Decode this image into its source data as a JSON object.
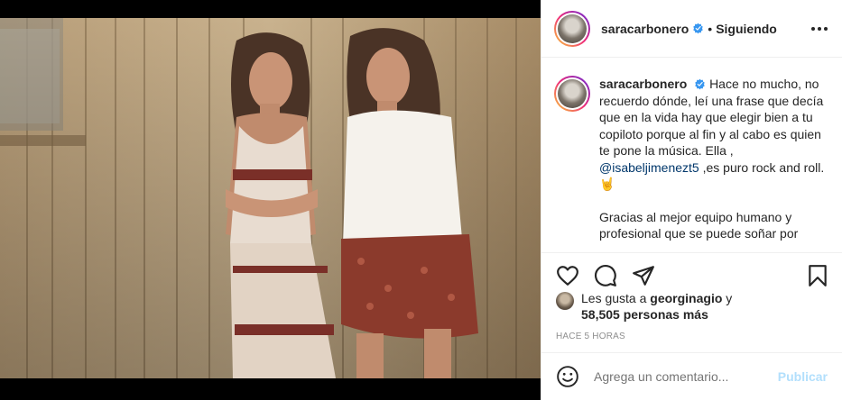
{
  "post": {
    "image_alt": "Two women leaning against a weathered wooden wall",
    "username": "saracarbonero",
    "separator": "•",
    "follow_status": "Siguiendo"
  },
  "caption": {
    "username": "saracarbonero",
    "text_before_mention": "Hace no mucho, no recuerdo dónde, leí una frase que decía que en la vida hay que elegir bien a tu copiloto porque al fin y al cabo es quien te pone la música. Ella ,",
    "mention": "@isabeljimenezt5",
    "text_after_mention": ",es puro rock and roll. 🤘",
    "second_paragraph": "Gracias al mejor equipo humano y profesional que se puede soñar por"
  },
  "likes": {
    "prefix": "Les gusta a",
    "liker": "georginagio",
    "conjunction": "y",
    "count_text": "58,505 personas más"
  },
  "timestamp": "HACE 5 HORAS",
  "comment": {
    "placeholder": "Agrega un comentario...",
    "publish_label": "Publicar"
  },
  "colors": {
    "verified": "#3897f0",
    "mention": "#00376b",
    "publish_disabled": "#b2dffc",
    "muted": "#8e8e8e"
  },
  "icons": [
    "verified-icon",
    "more-options-icon",
    "heart-icon",
    "comment-icon",
    "share-icon",
    "bookmark-icon",
    "emoji-icon"
  ]
}
